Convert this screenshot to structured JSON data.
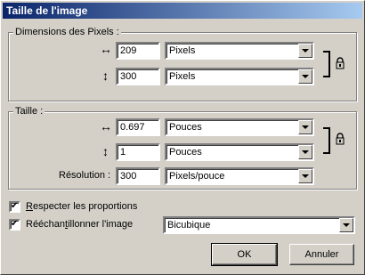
{
  "window": {
    "title": "Taille de l'image"
  },
  "pixel_dimensions": {
    "legend": "Dimensions des Pixels :",
    "width": {
      "arrow": "↔",
      "value": "209",
      "unit": "Pixels"
    },
    "height": {
      "arrow": "↕",
      "value": "300",
      "unit": "Pixels"
    },
    "lock_icon": "lock-icon"
  },
  "size": {
    "legend": "Taille :",
    "width": {
      "arrow": "↔",
      "value": "0.697",
      "unit": "Pouces"
    },
    "height": {
      "arrow": "↕",
      "value": "1",
      "unit": "Pouces"
    },
    "resolution": {
      "label": "Résolution :",
      "value": "300",
      "unit": "Pixels/pouce"
    },
    "lock_icon": "lock-icon"
  },
  "options": {
    "keep_proportions": {
      "label_first": "R",
      "label_rest": "especter les proportions",
      "checked": true
    },
    "resample": {
      "label_a": "Rééchan",
      "label_u": "t",
      "label_b": "illonner l'image",
      "checked": true,
      "method": "Bicubique"
    }
  },
  "buttons": {
    "ok": "OK",
    "cancel": "Annuler"
  }
}
